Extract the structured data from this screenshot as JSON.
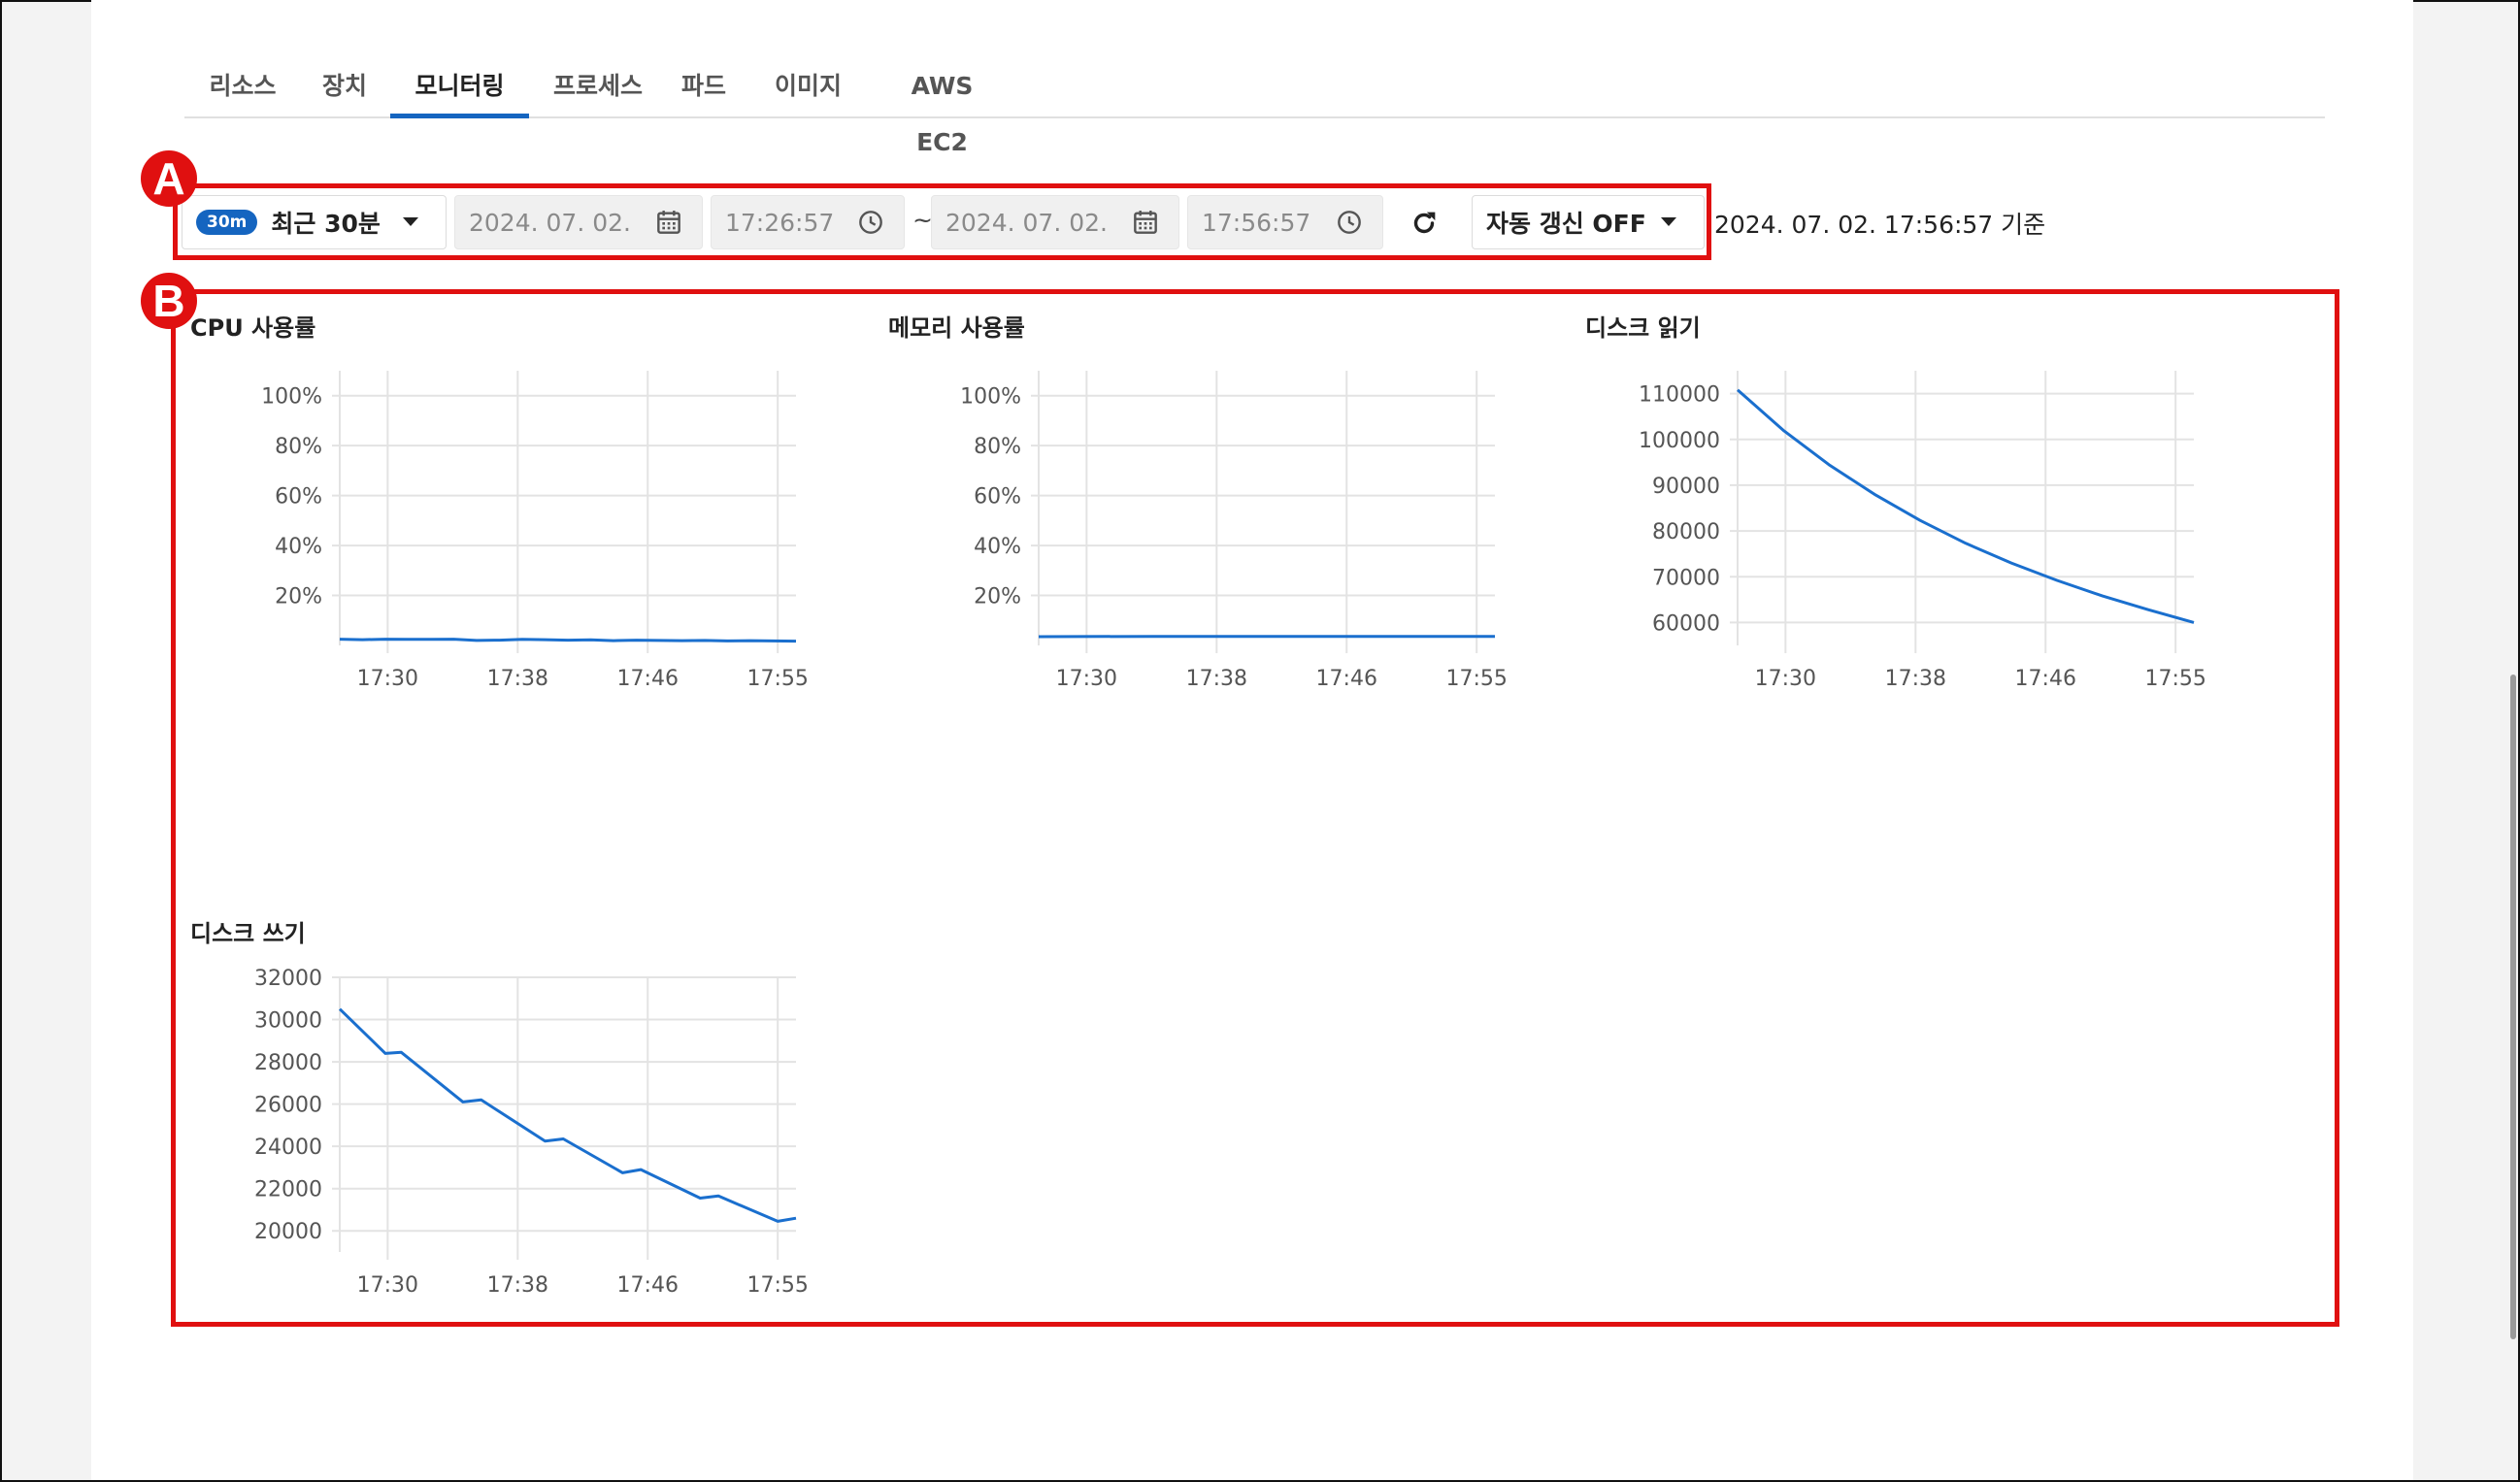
{
  "tabs": [
    {
      "label": "리소스"
    },
    {
      "label": "장치"
    },
    {
      "label": "모니터링",
      "active": true
    },
    {
      "label": "프로세스"
    },
    {
      "label": "파드"
    },
    {
      "label": "이미지"
    },
    {
      "label": "AWS EC2"
    }
  ],
  "toolbar": {
    "preset_badge": "30m",
    "preset_label": "최근 30분",
    "start_date": "2024. 07. 02.",
    "start_time": "17:26:57",
    "range_separator": "~",
    "end_date": "2024. 07. 02.",
    "end_time": "17:56:57",
    "auto_refresh_label": "자동 갱신 OFF",
    "timestamp": "2024. 07. 02. 17:56:57 기준",
    "refresh_icon": "refresh-icon",
    "calendar_icon": "calendar-icon",
    "clock_icon": "clock-icon"
  },
  "annotations": {
    "a": "A",
    "b": "B"
  },
  "colors": {
    "accent": "#1565c0",
    "annotation": "#e01010",
    "line": "#1a6fce",
    "grid": "#e3e3e3"
  },
  "chart_data": [
    {
      "type": "line",
      "title": "CPU 사용률",
      "x_ticks": [
        "17:30",
        "17:38",
        "17:46",
        "17:55"
      ],
      "y_ticks": [
        "20%",
        "40%",
        "60%",
        "80%",
        "100%"
      ],
      "ylim": [
        0,
        110
      ],
      "x": [
        0,
        0.05,
        0.1,
        0.15,
        0.2,
        0.25,
        0.3,
        0.35,
        0.4,
        0.45,
        0.5,
        0.55,
        0.6,
        0.65,
        0.7,
        0.75,
        0.8,
        0.85,
        0.9,
        0.95,
        1
      ],
      "values": [
        2.5,
        2.3,
        2.5,
        2.4,
        2.4,
        2.5,
        2.0,
        2.1,
        2.4,
        2.3,
        2.1,
        2.2,
        1.9,
        2.1,
        2.0,
        1.9,
        2.0,
        1.8,
        1.9,
        1.8,
        1.7
      ]
    },
    {
      "type": "line",
      "title": "메모리 사용률",
      "x_ticks": [
        "17:30",
        "17:38",
        "17:46",
        "17:55"
      ],
      "y_ticks": [
        "20%",
        "40%",
        "60%",
        "80%",
        "100%"
      ],
      "ylim": [
        0,
        110
      ],
      "x": [
        0,
        0.25,
        0.5,
        0.75,
        1
      ],
      "values": [
        3.5,
        3.6,
        3.6,
        3.6,
        3.6
      ]
    },
    {
      "type": "line",
      "title": "디스크 읽기",
      "x_ticks": [
        "17:30",
        "17:38",
        "17:46",
        "17:55"
      ],
      "y_ticks": [
        "60000",
        "70000",
        "80000",
        "90000",
        "100000",
        "110000"
      ],
      "ylim": [
        55000,
        115000
      ],
      "x": [
        0,
        0.1,
        0.2,
        0.3,
        0.4,
        0.5,
        0.6,
        0.7,
        0.8,
        0.9,
        1
      ],
      "values": [
        110800,
        102000,
        94500,
        88000,
        82300,
        77300,
        73000,
        69200,
        65800,
        62800,
        60000
      ]
    },
    {
      "type": "line",
      "title": "디스크 쓰기",
      "x_ticks": [
        "17:30",
        "17:38",
        "17:46",
        "17:55"
      ],
      "y_ticks": [
        "20000",
        "22000",
        "24000",
        "26000",
        "28000",
        "30000",
        "32000"
      ],
      "ylim": [
        19000,
        32000
      ],
      "x": [
        0,
        0.1,
        0.135,
        0.27,
        0.31,
        0.45,
        0.49,
        0.62,
        0.66,
        0.79,
        0.83,
        0.96,
        1
      ],
      "values": [
        30500,
        28400,
        28450,
        26100,
        26200,
        24250,
        24350,
        22750,
        22900,
        21550,
        21650,
        20450,
        20600
      ]
    }
  ]
}
